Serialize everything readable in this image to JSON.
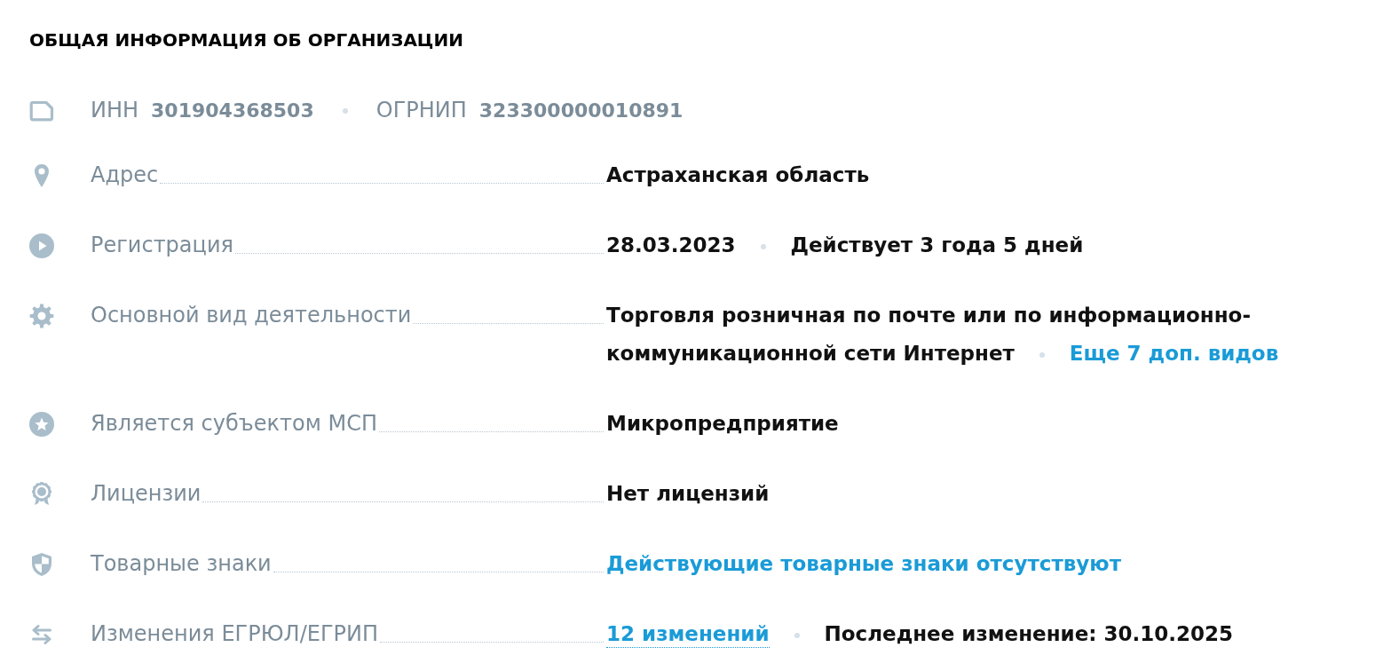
{
  "section": {
    "title": "ОБЩАЯ ИНФОРМАЦИЯ ОБ ОРГАНИЗАЦИИ"
  },
  "identifiers": [
    {
      "label": "ИНН",
      "value": "301904368503"
    },
    {
      "label": "ОГРНИП",
      "value": "323300000010891"
    }
  ],
  "rows": [
    {
      "label": "Адрес",
      "values": [
        {
          "kind": "text",
          "text": "Астраханская область"
        }
      ]
    },
    {
      "label": "Регистрация",
      "values": [
        {
          "kind": "text",
          "text": "28.03.2023"
        },
        {
          "kind": "text",
          "text": "Действует 3 года 5 дней"
        }
      ]
    },
    {
      "label": "Основной вид деятельности",
      "values": [
        {
          "kind": "lines",
          "lines": [
            "Торговля розничная по почте или по информационно-",
            "коммуникационной сети Интернет"
          ]
        },
        {
          "kind": "link",
          "text": "Еще 7 доп. видов",
          "underlined": false
        }
      ]
    },
    {
      "label": "Является субъектом МСП",
      "values": [
        {
          "kind": "text",
          "text": "Микропредприятие"
        }
      ]
    },
    {
      "label": "Лицензии",
      "values": [
        {
          "kind": "text",
          "text": "Нет лицензий"
        }
      ]
    },
    {
      "label": "Товарные знаки",
      "values": [
        {
          "kind": "link",
          "text": "Действующие товарные знаки отсутствуют",
          "underlined": false
        }
      ]
    },
    {
      "label": "Изменения ЕГРЮЛ/ЕГРИП",
      "values": [
        {
          "kind": "link",
          "text": "12 изменений",
          "underlined": true
        },
        {
          "kind": "text",
          "text": "Последнее изменение: 30.10.2025"
        }
      ]
    }
  ]
}
